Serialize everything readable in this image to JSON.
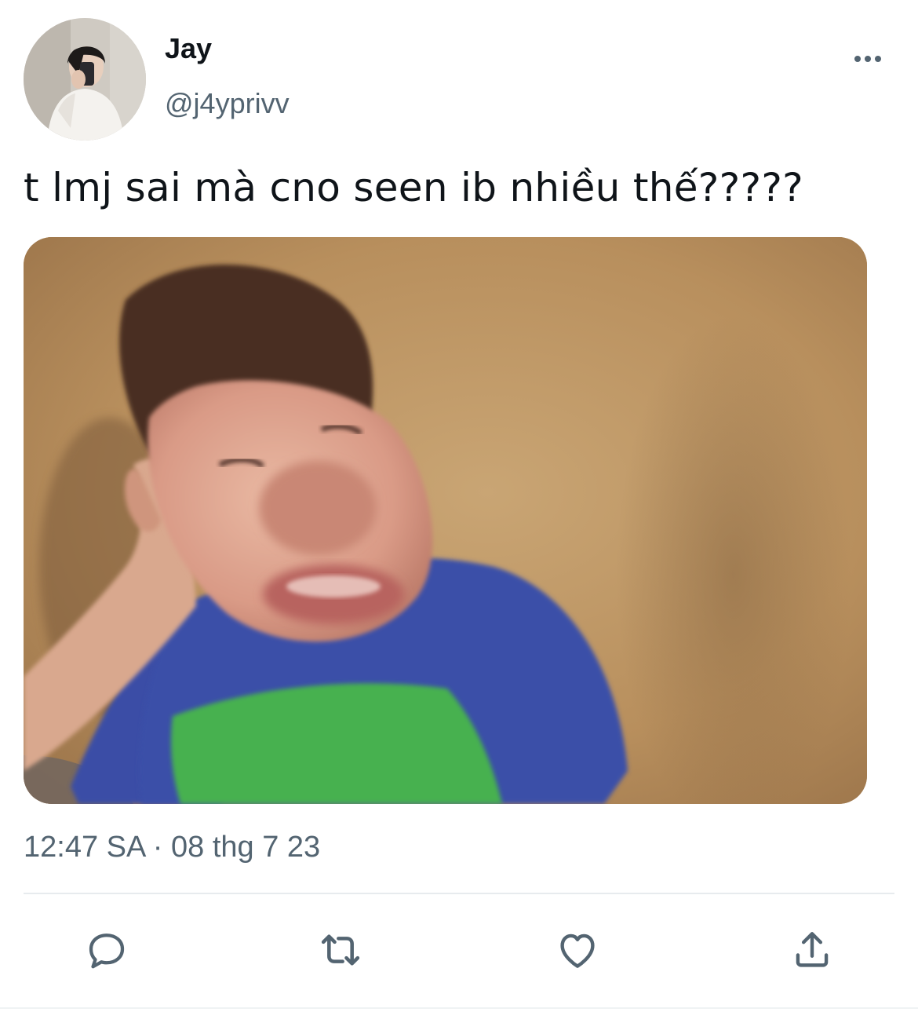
{
  "tweet": {
    "author": {
      "display_name": "Jay",
      "handle": "@j4yprivv",
      "avatar_icon": "profile-photo"
    },
    "more_icon": "more-horizontal-icon",
    "text": "t lmj sai mà cno seen ib nhiều thế?????",
    "media": {
      "kind": "photo"
    },
    "timestamp": "12:47 SA · 08 thg 7 23"
  },
  "actions": [
    {
      "name": "reply",
      "icon": "reply-icon"
    },
    {
      "name": "retweet",
      "icon": "retweet-icon"
    },
    {
      "name": "like",
      "icon": "heart-icon"
    },
    {
      "name": "share",
      "icon": "share-icon"
    }
  ],
  "colors": {
    "primary_text": "#0f1419",
    "secondary_text": "#536471",
    "divider": "#e7ebee",
    "background": "#ffffff"
  }
}
